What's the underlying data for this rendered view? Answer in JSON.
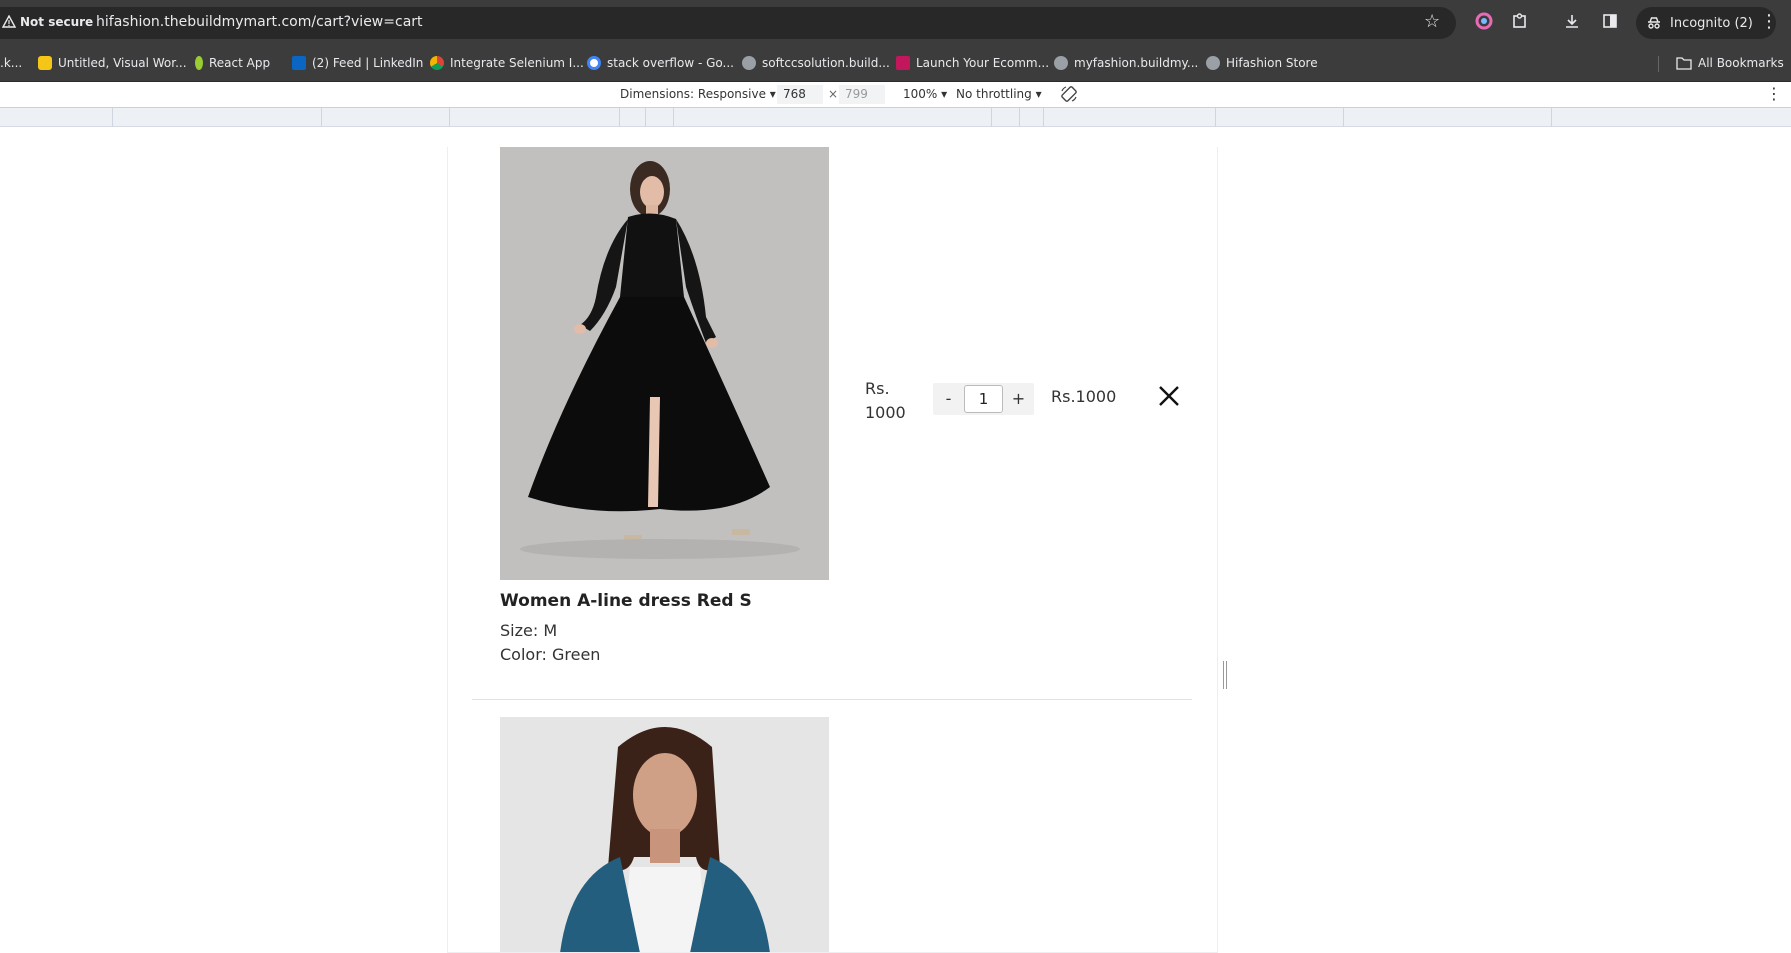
{
  "browser": {
    "security_label": "Not secure",
    "url": "hifashion.thebuildmymart.com/cart?view=cart",
    "incognito_label": "Incognito (2)",
    "all_bookmarks_label": "All Bookmarks",
    "bookmarks": [
      {
        "label": ".k...",
        "color": "#3c3c3c"
      },
      {
        "label": "Untitled, Visual Wor...",
        "color": "#f5c518"
      },
      {
        "label": "React App",
        "color": "#9acd32"
      },
      {
        "label": "(2) Feed | LinkedIn",
        "color": "#0a66c2"
      },
      {
        "label": "Integrate Selenium I...",
        "color": "#f4b400"
      },
      {
        "label": "stack overflow - Go...",
        "color": "#ffffff"
      },
      {
        "label": "softccsolution.build...",
        "color": "#9aa0a6"
      },
      {
        "label": "Launch Your Ecomm...",
        "color": "#c2185b"
      },
      {
        "label": "myfashion.buildmy...",
        "color": "#9aa0a6"
      },
      {
        "label": "Hifashion Store",
        "color": "#9aa0a6"
      }
    ]
  },
  "devtools": {
    "dimensions_label": "Dimensions: Responsive",
    "width": "768",
    "height": "799",
    "zoom": "100%",
    "throttling": "No throttling"
  },
  "cart": {
    "items": [
      {
        "name": "Women A-line dress Red S",
        "size": "Size: M",
        "color": "Color: Green",
        "price": "Rs. 1000",
        "quantity": "1",
        "subtotal": "Rs.1000",
        "minus": "-",
        "plus": "+"
      }
    ]
  },
  "colors": {
    "chrome_bg": "#3c3c3c",
    "omnibox_bg": "#282828",
    "text_dark": "#222222"
  }
}
